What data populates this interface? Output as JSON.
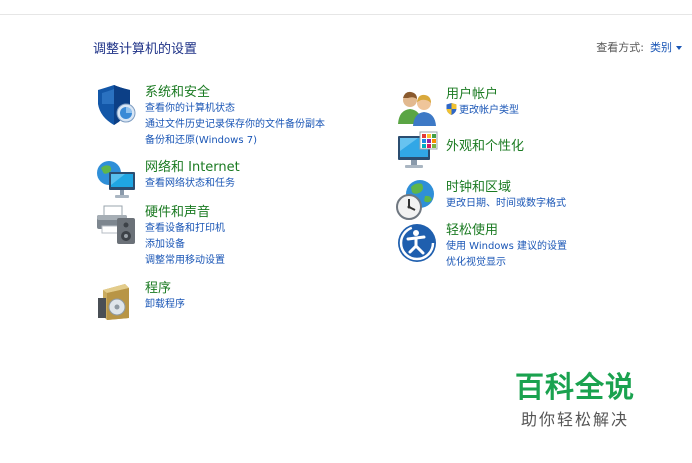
{
  "page_title": "调整计算机的设置",
  "view_by": {
    "label": "查看方式:",
    "value": "类别"
  },
  "categories": {
    "system_security": {
      "title": "系统和安全",
      "links": [
        "查看你的计算机状态",
        "通过文件历史记录保存你的文件备份副本",
        "备份和还原(Windows 7)"
      ]
    },
    "network": {
      "title": "网络和 Internet",
      "links": [
        "查看网络状态和任务"
      ]
    },
    "hardware": {
      "title": "硬件和声音",
      "links": [
        "查看设备和打印机",
        "添加设备",
        "调整常用移动设置"
      ]
    },
    "programs": {
      "title": "程序",
      "links": [
        "卸载程序"
      ]
    },
    "user_accounts": {
      "title": "用户帐户",
      "links": [
        "更改帐户类型"
      ]
    },
    "appearance": {
      "title": "外观和个性化",
      "links": []
    },
    "clock_region": {
      "title": "时钟和区域",
      "links": [
        "更改日期、时间或数字格式"
      ]
    },
    "ease_access": {
      "title": "轻松使用",
      "links": [
        "使用 Windows 建议的设置",
        "优化视觉显示"
      ]
    }
  },
  "watermark": {
    "title": "百科全说",
    "subtitle": "助你轻松解决"
  },
  "colors": {
    "title_green": "#1a7a21",
    "link_blue": "#1a56b6",
    "page_title": "#1e3287",
    "watermark_green": "#1aa24f"
  }
}
